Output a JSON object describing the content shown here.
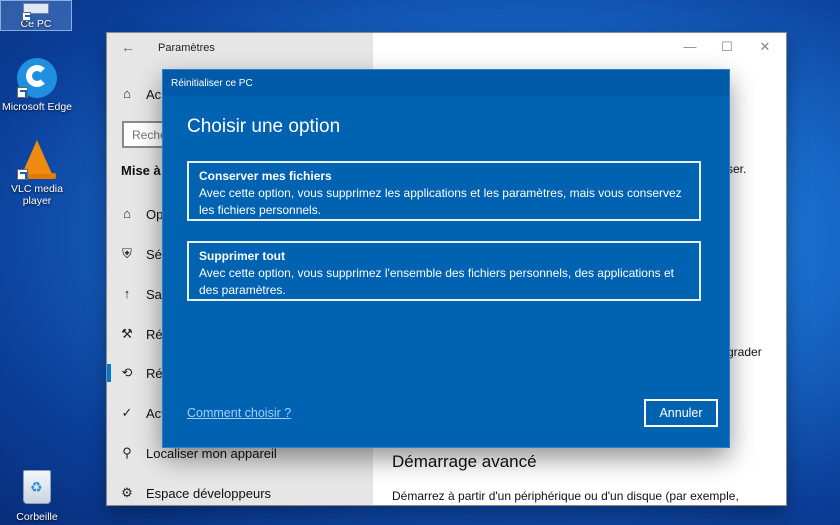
{
  "desktop": {
    "icons": [
      {
        "label": "Ce PC",
        "icon": "this-pc-icon"
      },
      {
        "label": "Microsoft Edge",
        "icon": "edge-icon"
      },
      {
        "label": "VLC media player",
        "icon": "vlc-icon"
      },
      {
        "label": "Corbeille",
        "icon": "recycle-bin-icon"
      }
    ]
  },
  "settings_window": {
    "title": "Paramètres",
    "controls": {
      "minimize": "—",
      "maximize": "☐",
      "close": "✕"
    },
    "home_label": "Ac",
    "search_placeholder": "Reche",
    "section_heading": "Mise à j",
    "nav_items": [
      {
        "label": "Op",
        "icon": "windows-update-icon"
      },
      {
        "label": "Séc",
        "icon": "shield-icon"
      },
      {
        "label": "Sau",
        "icon": "backup-arrow-icon"
      },
      {
        "label": "Rés",
        "icon": "wrench-icon"
      },
      {
        "label": "Réc",
        "icon": "recovery-icon"
      },
      {
        "label": "Act",
        "icon": "activation-check-icon"
      },
      {
        "label": "Localiser mon appareil",
        "icon": "location-person-icon"
      },
      {
        "label": "Espace développeurs",
        "icon": "developer-tools-icon"
      }
    ],
    "right_pane": {
      "partial_text_1": "ser.",
      "partial_text_2": "grader",
      "heading": "Démarrage avancé",
      "body_partial": "Démarrez à partir d'un périphérique ou d'un disque (par exemple,"
    }
  },
  "reset_dialog": {
    "title": "Réinitialiser ce PC",
    "heading": "Choisir une option",
    "options": [
      {
        "title": "Conserver mes fichiers",
        "description": "Avec cette option, vous supprimez les applications et les paramètres, mais vous conservez les fichiers personnels."
      },
      {
        "title": "Supprimer tout",
        "description": "Avec cette option, vous supprimez l'ensemble des fichiers personnels, des applications et des paramètres."
      }
    ],
    "help_link": "Comment choisir ?",
    "cancel_button": "Annuler"
  },
  "colors": {
    "dialog_background": "#0063b1",
    "accent": "#0078d7",
    "link": "#9fd0ff"
  }
}
